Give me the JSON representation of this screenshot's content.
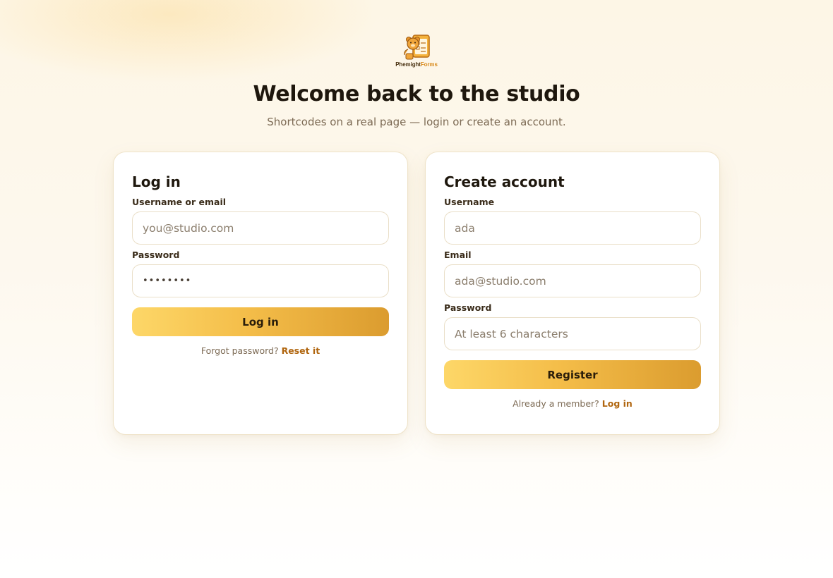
{
  "brand": {
    "logo_name_part1": "Phemight",
    "logo_name_part2": "Forms",
    "accent_color": "#d8891a"
  },
  "header": {
    "title": "Welcome back to the studio",
    "subtitle": "Shortcodes on a real page — login or create an account."
  },
  "login": {
    "title": "Log in",
    "username_label": "Username or email",
    "username_placeholder": "you@studio.com",
    "password_label": "Password",
    "password_value": "••••••••",
    "submit_label": "Log in",
    "forgot_text": "Forgot password?",
    "reset_link": "Reset it"
  },
  "register": {
    "title": "Create account",
    "username_label": "Username",
    "username_placeholder": "ada",
    "email_label": "Email",
    "email_placeholder": "ada@studio.com",
    "password_label": "Password",
    "password_placeholder": "At least 6 characters",
    "submit_label": "Register",
    "member_text": "Already a member?",
    "login_link": "Log in"
  }
}
